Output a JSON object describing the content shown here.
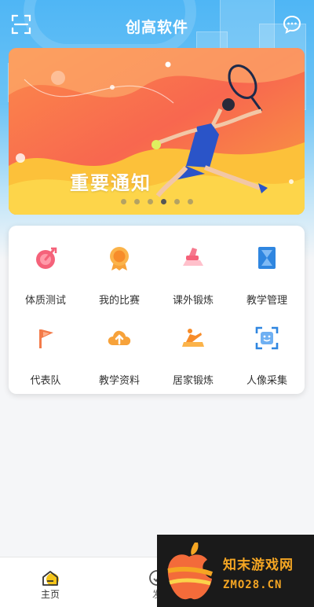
{
  "app": {
    "title": "创高软件"
  },
  "banner": {
    "text": "重要通知",
    "page_count": 6,
    "active_index": 3
  },
  "menu": [
    {
      "label": "体质测试",
      "icon": "fitness-test-icon"
    },
    {
      "label": "我的比赛",
      "icon": "medal-icon"
    },
    {
      "label": "课外锻炼",
      "icon": "exercise-icon"
    },
    {
      "label": "教学管理",
      "icon": "hourglass-icon"
    },
    {
      "label": "代表队",
      "icon": "flag-icon"
    },
    {
      "label": "教学资料",
      "icon": "cloud-upload-icon"
    },
    {
      "label": "居家锻炼",
      "icon": "home-exercise-icon"
    },
    {
      "label": "人像采集",
      "icon": "face-scan-icon"
    }
  ],
  "tabs": [
    {
      "label": "主页",
      "active": true
    },
    {
      "label": "发"
    }
  ],
  "watermark": {
    "line1": "知末游戏网",
    "line2": "ZMO28.CN"
  },
  "colors": {
    "accent": "#f5a623",
    "header_blue": "#4fb6f5",
    "banner_orange": "#f86c4f",
    "banner_yellow": "#fbc02d"
  }
}
